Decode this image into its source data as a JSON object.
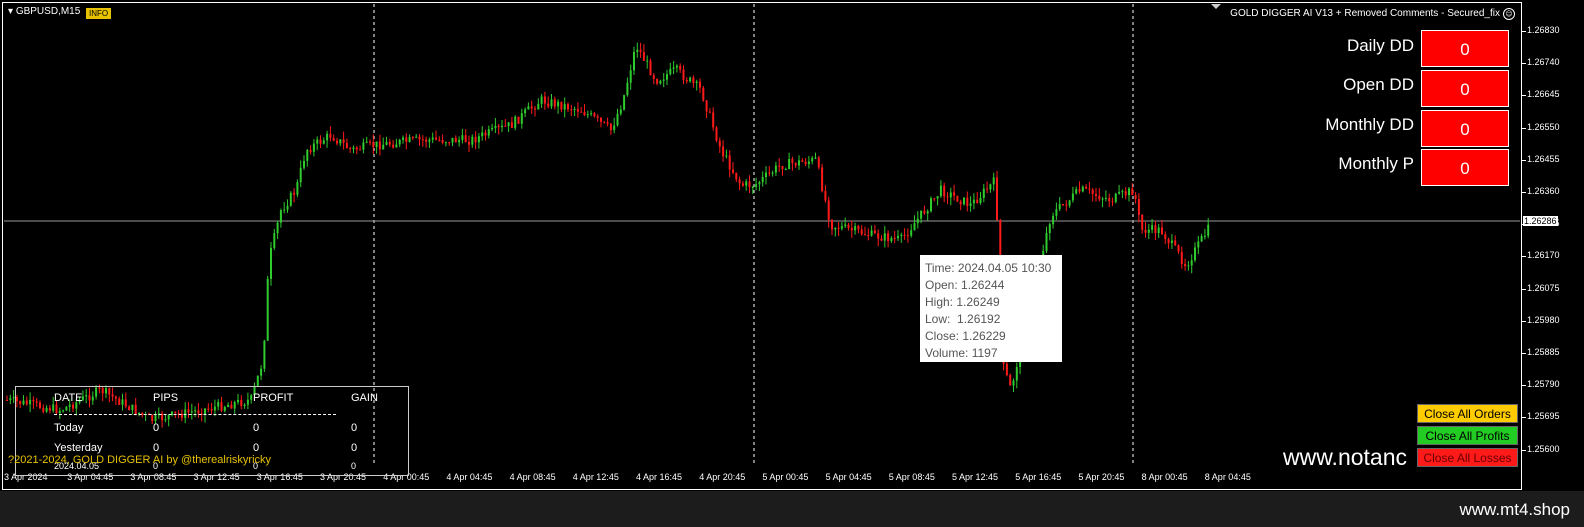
{
  "chart": {
    "symbol": "GBPUSD,M15",
    "info_badge": "INFO",
    "ea_title": "GOLD DIGGER AI V13 + Removed Comments - Secured_fix",
    "current_price": "1.26286",
    "price_labels": [
      "1.26830",
      "1.26740",
      "1.26645",
      "1.26550",
      "1.26455",
      "1.26360",
      "1.26265",
      "1.26170",
      "1.26075",
      "1.25980",
      "1.25885",
      "1.25790",
      "1.25695",
      "1.25600"
    ],
    "time_labels": [
      "3 Apr 2024",
      "3 Apr 04:45",
      "3 Apr 08:45",
      "3 Apr 12:45",
      "3 Apr 16:45",
      "3 Apr 20:45",
      "4 Apr 00:45",
      "4 Apr 04:45",
      "4 Apr 08:45",
      "4 Apr 12:45",
      "4 Apr 16:45",
      "4 Apr 20:45",
      "5 Apr 00:45",
      "5 Apr 04:45",
      "5 Apr 08:45",
      "5 Apr 12:45",
      "5 Apr 16:45",
      "5 Apr 20:45",
      "8 Apr 00:45",
      "8 Apr 04:45"
    ],
    "colors": {
      "bull": "#2ecc2e",
      "bear": "#ff1a1a",
      "background": "#000000"
    }
  },
  "dd_panel": [
    {
      "label": "Daily DD",
      "value": "0"
    },
    {
      "label": "Open DD",
      "value": "0"
    },
    {
      "label": "Monthly DD",
      "value": "0"
    },
    {
      "label": "Monthly P",
      "value": "0"
    }
  ],
  "tooltip": {
    "time": "Time: 2024.04.05 10:30",
    "open": "Open: 1.26244",
    "high": "High: 1.26249",
    "low": "Low:  1.26192",
    "close": "Close: 1.26229",
    "volume": "Volume: 1197"
  },
  "stats": {
    "headers": {
      "date": "DATE",
      "pips": "PIPS",
      "profit": "PROFIT",
      "gain": "GAIN"
    },
    "rows": [
      {
        "date": "Today",
        "pips": "0",
        "profit": "0",
        "gain": "0"
      },
      {
        "date": "Yesterday",
        "pips": "0",
        "profit": "0",
        "gain": "0"
      },
      {
        "date": "2024.04.05",
        "pips": "0",
        "profit": "0",
        "gain": "0"
      }
    ]
  },
  "copyright": "?2021-2024, GOLD DIGGER AI by @therealriskyricky",
  "watermark": "www.notanc",
  "buttons": {
    "close_all_orders": {
      "label": "Close All Orders",
      "color": "#ffcc00"
    },
    "close_all_profits": {
      "label": "Close All Profits",
      "color": "#22cc22"
    },
    "close_all_losses": {
      "label": "Close All Losses",
      "color": "#ff1a1a"
    }
  },
  "footer_brand": "www.mt4.shop"
}
